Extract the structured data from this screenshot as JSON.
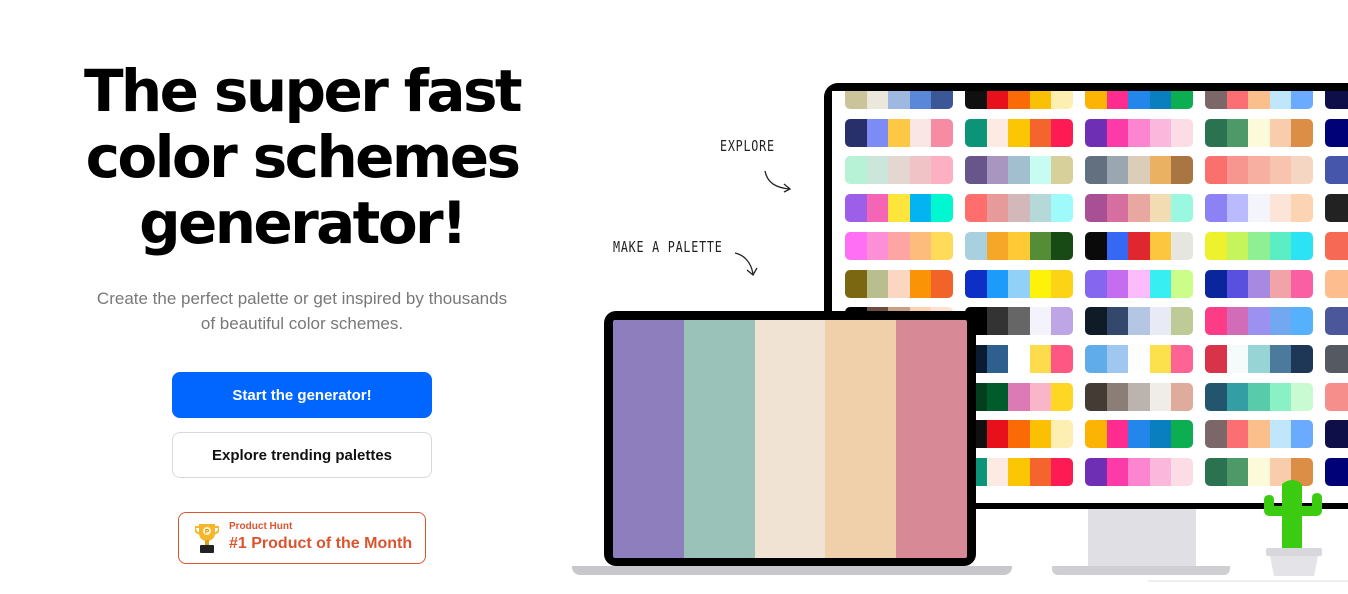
{
  "hero": {
    "title_lines": [
      "The super fast",
      "color schemes",
      "generator!"
    ],
    "subtitle": "Create the perfect palette or get inspired by thousands of beautiful color schemes.",
    "primary_button": "Start the generator!",
    "secondary_button": "Explore trending palettes",
    "badge": {
      "kicker": "Product Hunt",
      "title": "#1 Product of the Month",
      "color": "#da552f",
      "icon": "trophy-icon"
    }
  },
  "illustration": {
    "annotations": {
      "explore": "EXPLORE",
      "make_palette": "MAKE A PALETTE"
    },
    "laptop_palette": [
      "#8e7ebd",
      "#9bc2b8",
      "#f1e3d3",
      "#f0d0aa",
      "#d78a95"
    ],
    "monitor_palettes": [
      [
        [
          "#cbc39a",
          "#ebe7dc",
          "#9fb8e0",
          "#5a87d8",
          "#3b5797"
        ],
        [
          "#101010",
          "#e8101a",
          "#fa6b08",
          "#fbbf04",
          "#fdeeb2"
        ],
        [
          "#fbb404",
          "#fd2c8e",
          "#2286ea",
          "#0a7fbf",
          "#0cae52"
        ],
        [
          "#7b6768",
          "#fb6e73",
          "#fbbf8b",
          "#bfe6fb",
          "#6aaaff"
        ],
        [
          "#0e0e48"
        ]
      ],
      [
        [
          "#27306a",
          "#7d8bf5",
          "#fdc843",
          "#fbe6e6",
          "#f78ba4"
        ],
        [
          "#0c9478",
          "#fdeae2",
          "#fcc604",
          "#f3652c",
          "#fe1a52"
        ],
        [
          "#6f2fb4",
          "#fc3ba9",
          "#fd84ce",
          "#fcb7dc",
          "#fddde5"
        ],
        [
          "#2b7350",
          "#4d9968",
          "#fcfad8",
          "#f9cdac",
          "#dd8e46"
        ],
        [
          "#010177"
        ]
      ],
      [
        [
          "#b8f2d6",
          "#cde6db",
          "#e4d7d1",
          "#f0c4c6",
          "#fdb0c2"
        ],
        [
          "#67558b",
          "#a896c0",
          "#a2bfd0",
          "#c8fbf1",
          "#d8d09b"
        ],
        [
          "#637080",
          "#9aa6b0",
          "#dbcdba",
          "#e9b161",
          "#a97542"
        ],
        [
          "#f9706d",
          "#f6968e",
          "#f6afa0",
          "#f8c4b0",
          "#f5d6c3"
        ],
        [
          "#4656aa"
        ]
      ],
      [
        [
          "#9d5ee8",
          "#f465b6",
          "#fde53b",
          "#04b4f0",
          "#00f7d0"
        ],
        [
          "#fe6e6c",
          "#e69b9a",
          "#d4b7b9",
          "#b5d9d9",
          "#9ffbfb"
        ],
        [
          "#a84f96",
          "#d66e9f",
          "#e8a7a0",
          "#f2dcb1",
          "#9af8e1"
        ],
        [
          "#8d82f3",
          "#b9baff",
          "#f4f4fc",
          "#fde4d8",
          "#fcd4b4"
        ],
        [
          "#222222"
        ]
      ],
      [
        [
          "#fe6ff6",
          "#fd8fd6",
          "#fda5a2",
          "#fdbc7c",
          "#fedc59"
        ],
        [
          "#a8d0de",
          "#f6a727",
          "#fdc934",
          "#558d36",
          "#174a14"
        ],
        [
          "#0a0a0a",
          "#3668f6",
          "#e0272f",
          "#fcc73e",
          "#e5e6df"
        ],
        [
          "#eef22c",
          "#c5f45b",
          "#8ef093",
          "#5cedc4",
          "#2be3f5"
        ],
        [
          "#f66a55"
        ]
      ],
      [
        [
          "#7b6612",
          "#b9be8e",
          "#fbd6c1",
          "#fb9306",
          "#f16329"
        ],
        [
          "#0e2fc5",
          "#1d9bfb",
          "#91d1f7",
          "#fdf30a",
          "#fdd315"
        ],
        [
          "#8467ee",
          "#c56df1",
          "#fcbbfb",
          "#37eef3",
          "#cbfe88"
        ],
        [
          "#0b269c",
          "#5a50e0",
          "#a789e2",
          "#f2a3a8",
          "#fb5fa3"
        ],
        [
          "#fdbd8e"
        ]
      ],
      [
        [
          "#000000",
          "#6c4d40",
          "#c5a087",
          "#fcd3b2",
          "#fee1d3"
        ],
        [
          "#000000",
          "#333333",
          "#666666",
          "#f4f2fb",
          "#bea6e6"
        ],
        [
          "#0f1c27",
          "#34486d",
          "#b5c6e3",
          "#e8eaf6",
          "#bfcb97"
        ],
        [
          "#fc3c87",
          "#d26bb8",
          "#9c90f1",
          "#71a8f1",
          "#56b1fc"
        ],
        [
          "#4b579a"
        ]
      ],
      [
        [
          "#0e3a52",
          "#2a6786",
          "#4ea4c0",
          "#ebe6df",
          "#fca43b"
        ],
        [
          "#0b1c32",
          "#2f5f8e",
          "#ffffff",
          "#fcdc4c",
          "#fe5783"
        ],
        [
          "#60abea",
          "#9fc7f0",
          "#fdfdfd",
          "#fce04c",
          "#fe6395"
        ],
        [
          "#d9334a",
          "#f5fbfb",
          "#96d4d6",
          "#4b7a9c",
          "#1e3756"
        ],
        [
          "#555a62"
        ]
      ],
      [
        [
          "#262525",
          "#3e3d3d",
          "#d74c49",
          "#fdbc7b",
          "#fedebd"
        ],
        [
          "#033e1e",
          "#005c2b",
          "#db7ab4",
          "#f9b6c8",
          "#fdd723"
        ],
        [
          "#453b35",
          "#8a7e76",
          "#bbb4ae",
          "#f0ede8",
          "#dfab9c"
        ],
        [
          "#22566f",
          "#339ea4",
          "#58ccaa",
          "#8af1c4",
          "#c8fbd2"
        ],
        [
          "#f68e8c"
        ]
      ],
      [
        [
          "#101010",
          "#e8101a",
          "#fa6b08",
          "#fbbf04",
          "#fdeeb2"
        ],
        [
          "#101010",
          "#e8101a",
          "#fa6b08",
          "#fbbf04",
          "#fdeeb2"
        ],
        [
          "#fbb404",
          "#fd2c8e",
          "#2286ea",
          "#0a7fbf",
          "#0cae52"
        ],
        [
          "#7b6768",
          "#fb6e73",
          "#fbbf8b",
          "#bfe6fb",
          "#6aaaff"
        ],
        [
          "#0e0e48"
        ]
      ],
      [
        [
          "#27306a",
          "#0c9478",
          "#fdc843",
          "#fbe6e6",
          "#f78ba4"
        ],
        [
          "#0c9478",
          "#fdeae2",
          "#fcc604",
          "#f3652c",
          "#fe1a52"
        ],
        [
          "#6f2fb4",
          "#fc3ba9",
          "#fd84ce",
          "#fcb7dc",
          "#fddde5"
        ],
        [
          "#2b7350",
          "#4d9968",
          "#fcfad8",
          "#f9cdac",
          "#dd8e46"
        ],
        [
          "#010177"
        ]
      ]
    ],
    "cactus_color": "#3bcc12"
  }
}
